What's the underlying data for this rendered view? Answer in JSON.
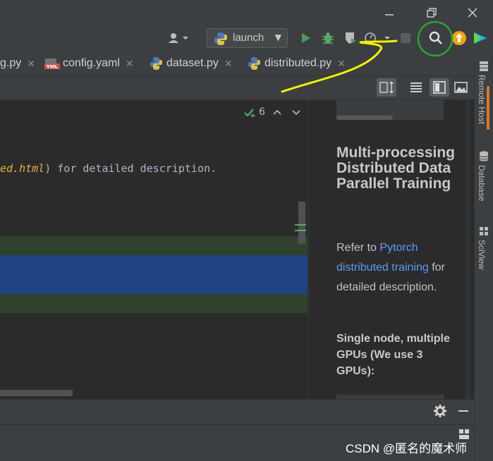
{
  "toolbar": {
    "run_config_label": "launch"
  },
  "tabs": [
    {
      "label": "g.py"
    },
    {
      "label": "config.yaml"
    },
    {
      "label": "dataset.py"
    },
    {
      "label": "distributed.py"
    }
  ],
  "tab_icon_yml_label": "YML",
  "editor": {
    "inspection_count": "6",
    "line_link": "ed.html",
    "line_paren": ")",
    "line_rest": " for detailed description."
  },
  "preview": {
    "heading": "Multi-processing Distributed Data Parallel Training",
    "para_prefix": "Refer to ",
    "para_link": "Pytorch distributed training",
    "para_suffix": " for detailed description.",
    "subheading": "Single node, multiple GPUs (We use 3 GPUs):"
  },
  "right_tools": {
    "remote_host": "Remote Host",
    "database": "Database",
    "sciview": "SciView"
  },
  "watermark": "CSDN @匿名的魔术师",
  "colors": {
    "run_green": "#499c54",
    "debug_green": "#59a869",
    "link_blue": "#589df6",
    "selection_blue": "#214283",
    "annotation_yellow": "#f4f100",
    "annotation_green": "#2aa52a"
  }
}
